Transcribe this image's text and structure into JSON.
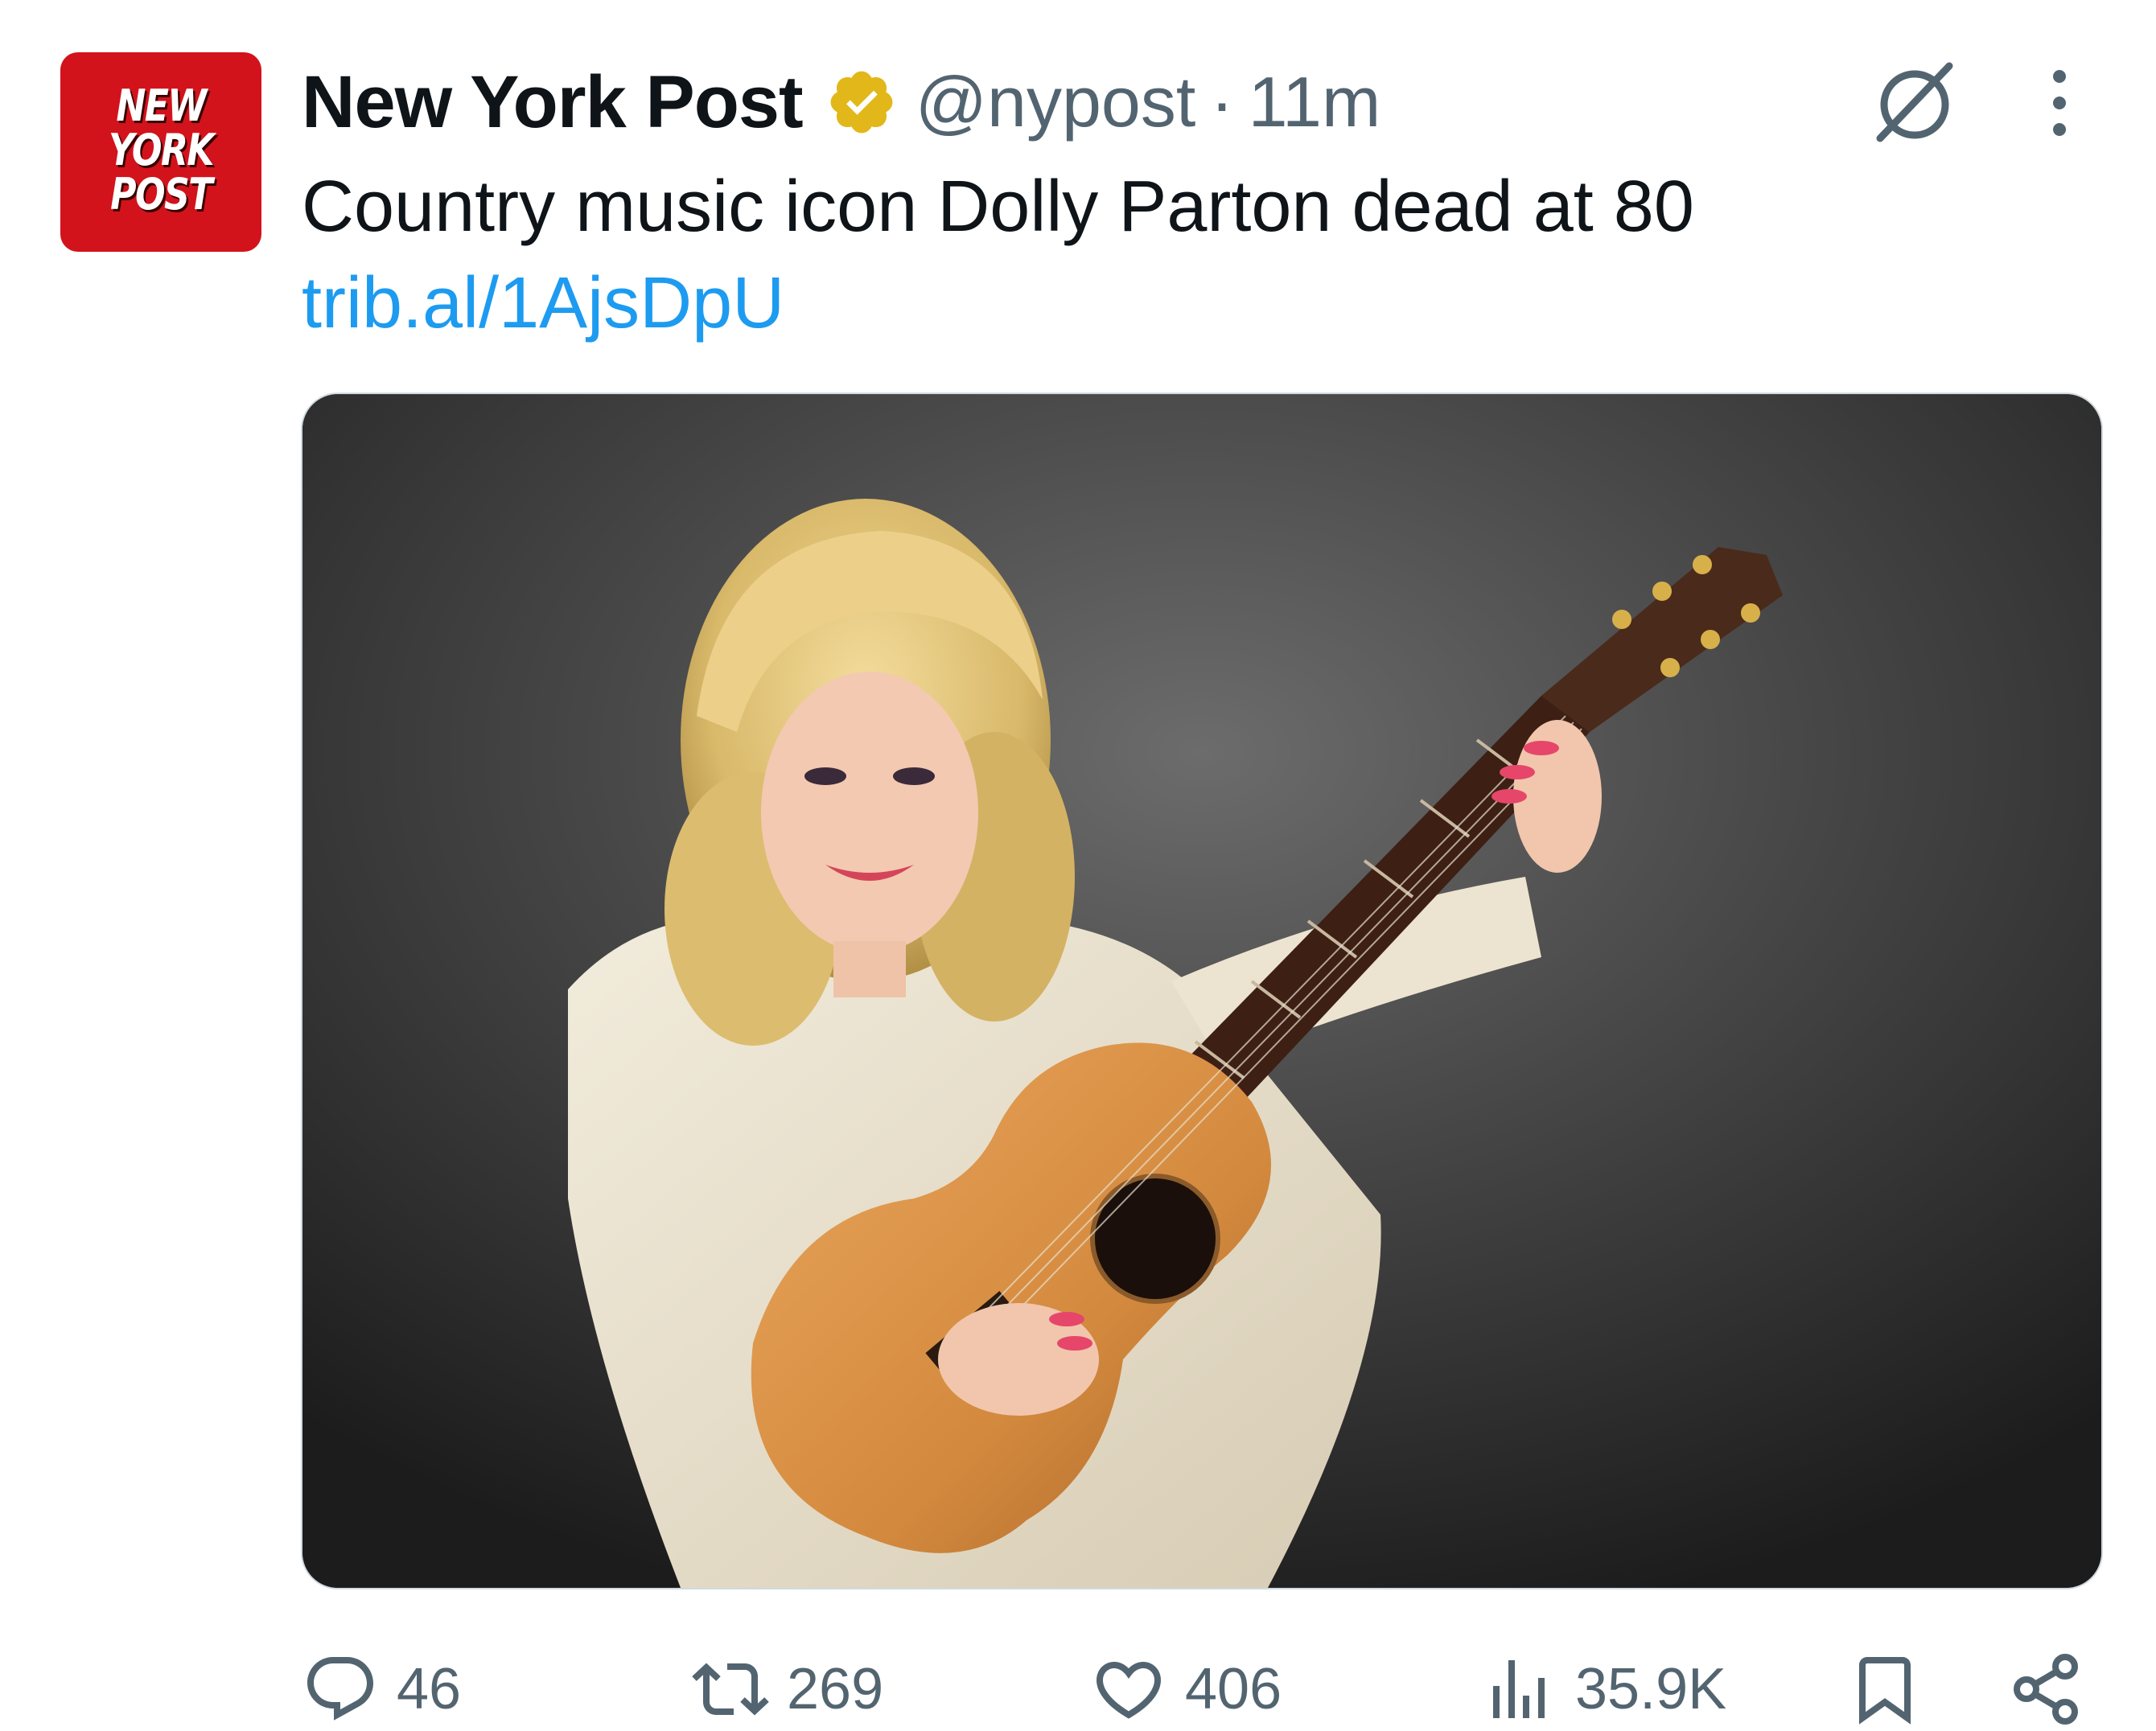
{
  "tweet": {
    "author": {
      "display_name": "New York Post",
      "handle": "@nypost",
      "separator": "·",
      "time": "11m",
      "verified": true,
      "avatar_text": [
        "NEW",
        "YORK",
        "POST"
      ]
    },
    "text": "Country music icon Dolly Parton dead at 80",
    "link": "trib.al/1AjsDpU",
    "media": {
      "description_icon": "photo-woman-with-guitar"
    },
    "actions": {
      "replies": "46",
      "reposts": "269",
      "likes": "406",
      "views": "35.9K"
    }
  },
  "colors": {
    "brand_red": "#d2131c",
    "link_blue": "#1d9bf0",
    "verified_gold": "#e2b719",
    "secondary_text": "#536471"
  },
  "icons": {
    "grok": "grok-icon",
    "more": "more-icon",
    "reply": "reply-icon",
    "repost": "repost-icon",
    "like": "heart-icon",
    "views": "views-icon",
    "bookmark": "bookmark-icon",
    "share": "share-icon"
  }
}
